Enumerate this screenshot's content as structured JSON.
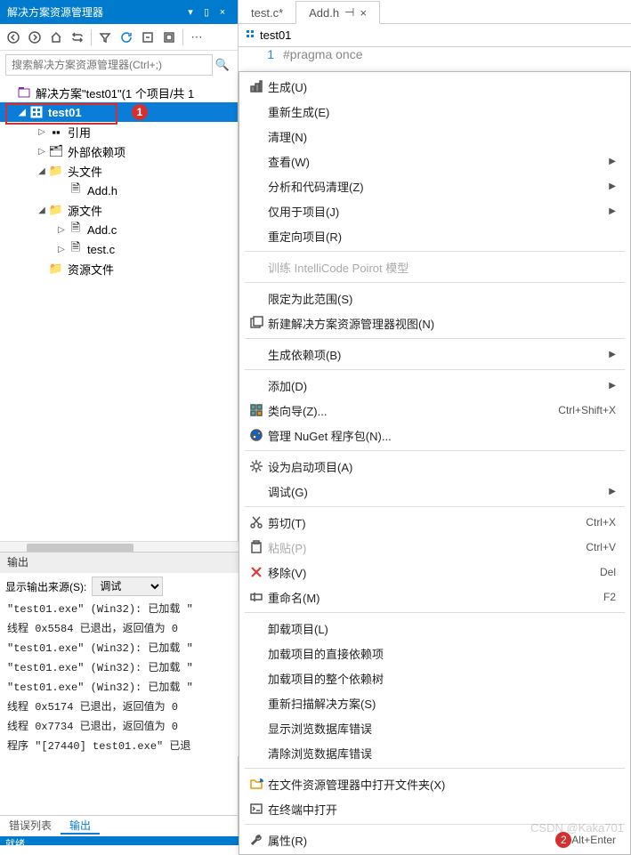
{
  "solution_explorer": {
    "title": "解决方案资源管理器",
    "search_placeholder": "搜索解决方案资源管理器(Ctrl+;)",
    "solution_label": "解决方案\"test01\"(1 个项目/共 1",
    "project_name": "test01",
    "nodes": {
      "references": "引用",
      "external_deps": "外部依赖项",
      "header_files": "头文件",
      "add_h": "Add.h",
      "source_files": "源文件",
      "add_c": "Add.c",
      "test_c": "test.c",
      "resource_files": "资源文件"
    },
    "badge1": "1"
  },
  "editor": {
    "tab1": "test.c*",
    "tab2": "Add.h",
    "tab2_pin": "⊣",
    "tab2_close": "×",
    "nav_scope": "test01",
    "line_no": "1",
    "code_line": "#pragma once"
  },
  "context_menu": [
    {
      "icon": "build",
      "label": "生成(U)"
    },
    {
      "label": "重新生成(E)"
    },
    {
      "label": "清理(N)"
    },
    {
      "label": "查看(W)",
      "sub": true
    },
    {
      "label": "分析和代码清理(Z)",
      "sub": true
    },
    {
      "label": "仅用于项目(J)",
      "sub": true
    },
    {
      "label": "重定向项目(R)"
    },
    {
      "sep": true
    },
    {
      "label": "训练 IntelliCode Poirot 模型",
      "disabled": true
    },
    {
      "sep": true
    },
    {
      "label": "限定为此范围(S)"
    },
    {
      "icon": "newview",
      "label": "新建解决方案资源管理器视图(N)"
    },
    {
      "sep": true
    },
    {
      "label": "生成依赖项(B)",
      "sub": true
    },
    {
      "sep": true
    },
    {
      "label": "添加(D)",
      "sub": true
    },
    {
      "icon": "wizard",
      "label": "类向导(Z)...",
      "short": "Ctrl+Shift+X"
    },
    {
      "icon": "nuget",
      "label": "管理 NuGet 程序包(N)..."
    },
    {
      "sep": true
    },
    {
      "icon": "gear",
      "label": "设为启动项目(A)"
    },
    {
      "label": "调试(G)",
      "sub": true
    },
    {
      "sep": true
    },
    {
      "icon": "cut",
      "label": "剪切(T)",
      "short": "Ctrl+X"
    },
    {
      "icon": "paste",
      "label": "粘贴(P)",
      "short": "Ctrl+V",
      "disabled": true
    },
    {
      "icon": "remove",
      "label": "移除(V)",
      "short": "Del"
    },
    {
      "icon": "rename",
      "label": "重命名(M)",
      "short": "F2"
    },
    {
      "sep": true
    },
    {
      "label": "卸载项目(L)"
    },
    {
      "label": "加载项目的直接依赖项"
    },
    {
      "label": "加载项目的整个依赖树"
    },
    {
      "label": "重新扫描解决方案(S)"
    },
    {
      "label": "显示浏览数据库错误"
    },
    {
      "label": "清除浏览数据库错误"
    },
    {
      "sep": true
    },
    {
      "icon": "folder",
      "label": "在文件资源管理器中打开文件夹(X)"
    },
    {
      "icon": "terminal",
      "label": "在终端中打开"
    },
    {
      "sep": true
    },
    {
      "icon": "wrench",
      "label": "属性(R)",
      "short": "Alt+Enter",
      "badge": "2"
    }
  ],
  "output": {
    "title": "输出",
    "src_label": "显示输出来源(S):",
    "src_value": "调试",
    "lines": [
      "\"test01.exe\" (Win32): 已加载 \"",
      "线程 0x5584 已退出，返回值为 0",
      "\"test01.exe\" (Win32): 已加载 \"",
      "\"test01.exe\" (Win32): 已加载 \"",
      "\"test01.exe\" (Win32): 已加载 \"",
      "线程 0x5174 已退出，返回值为 0",
      "线程 0x7734 已退出，返回值为 0",
      "程序 \"[27440] test01.exe\" 已退"
    ]
  },
  "bottom_tabs": {
    "errors": "错误列表",
    "output": "输出"
  },
  "status": "就绪",
  "watermark": "CSDN @Kaka701"
}
